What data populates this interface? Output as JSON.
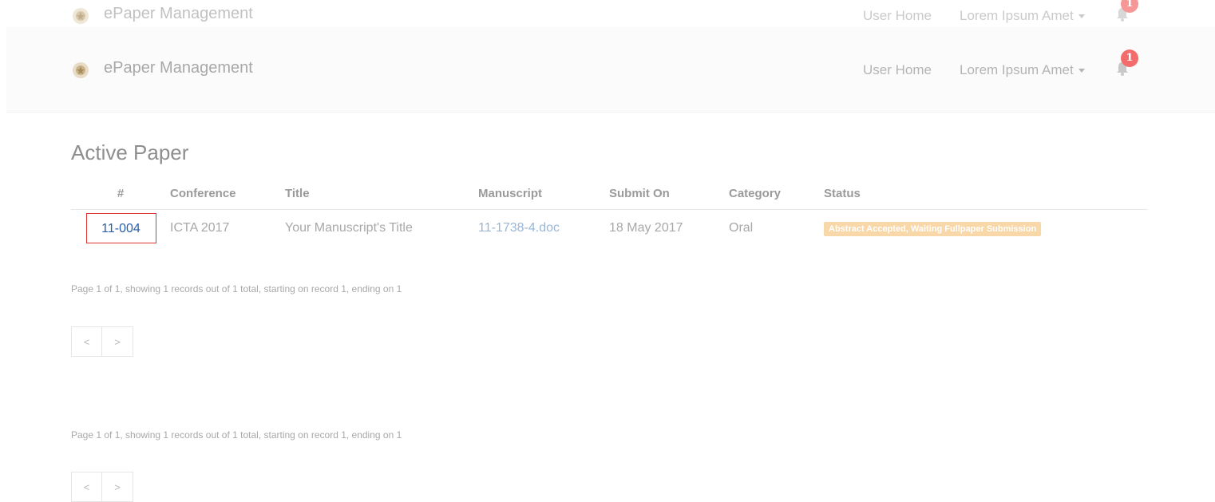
{
  "header": {
    "brand": "ePaper Management",
    "nav_home": "User Home",
    "nav_user": "Lorem Ipsum Amet",
    "notification_count": "1"
  },
  "main": {
    "title": "Active Paper",
    "table": {
      "columns": [
        "#",
        "Conference",
        "Title",
        "Manuscript",
        "Submit On",
        "Category",
        "Status"
      ],
      "rows": [
        {
          "id": "11-004",
          "conference": "ICTA 2017",
          "title": "Your Manuscript's Title",
          "manuscript": "11-1738-4.doc",
          "submit_on": "18 May 2017",
          "category": "Oral",
          "status": "Abstract Accepted, Waiting Fullpaper Submission"
        }
      ]
    },
    "pager_text": "Page 1 of 1, showing 1 records out of 1 total, starting on record 1, ending on 1",
    "pager_prev": "<",
    "pager_next": ">"
  },
  "icons": {
    "brand": "emblem-icon",
    "notification": "bell-icon"
  },
  "colors": {
    "badge": "#f36b6b",
    "status": "#f8d7a9",
    "link": "#2a5fa8",
    "highlight_border": "#dd3333"
  }
}
